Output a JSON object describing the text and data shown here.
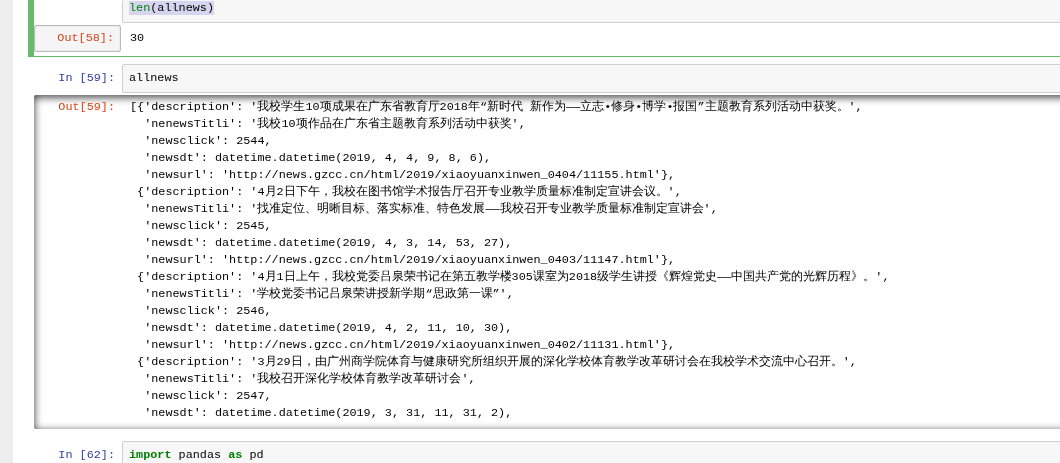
{
  "cells": [
    {
      "selected": true,
      "input": {
        "highlighted": true,
        "code": [
          {
            "text": "len",
            "kind": "builtin"
          },
          {
            "text": "(allnews)",
            "kind": "plain"
          }
        ]
      },
      "output": {
        "prompt": "Out[58]:",
        "hovered": true,
        "scrolled": false,
        "lines": [
          "30"
        ]
      }
    },
    {
      "selected": false,
      "input": {
        "prompt": "In [59]:",
        "highlighted": false,
        "code": [
          {
            "text": "allnews",
            "kind": "plain"
          }
        ]
      },
      "output": {
        "prompt": "Out[59]:",
        "hovered": false,
        "scrolled": true,
        "lines": [
          "[{'description': '我校学生10项成果在广东省教育厅2018年“新时代 新作为——立志•修身•博学•报国”主题教育系列活动中获奖。',",
          "  'nenewsTitli': '我校10项作品在广东省主题教育系列活动中获奖',",
          "  'newsclick': 2544,",
          "  'newsdt': datetime.datetime(2019, 4, 4, 9, 8, 6),",
          "  'newsurl': 'http://news.gzcc.cn/html/2019/xiaoyuanxinwen_0404/11155.html'},",
          " {'description': '4月2日下午，我校在图书馆学术报告厅召开专业教学质量标准制定宣讲会议。',",
          "  'nenewsTitli': '找准定位、明晰目标、落实标准、特色发展——我校召开专业教学质量标准制定宣讲会',",
          "  'newsclick': 2545,",
          "  'newsdt': datetime.datetime(2019, 4, 3, 14, 53, 27),",
          "  'newsurl': 'http://news.gzcc.cn/html/2019/xiaoyuanxinwen_0403/11147.html'},",
          " {'description': '4月1日上午，我校党委吕泉荣书记在第五教学楼305课室为2018级学生讲授《辉煌党史——中国共产党的光辉历程》。',",
          "  'nenewsTitli': '学校党委书记吕泉荣讲授新学期“思政第一课”',",
          "  'newsclick': 2546,",
          "  'newsdt': datetime.datetime(2019, 4, 2, 11, 10, 30),",
          "  'newsurl': 'http://news.gzcc.cn/html/2019/xiaoyuanxinwen_0402/11131.html'},",
          " {'description': '3月29日，由广州商学院体育与健康研究所组织开展的深化学校体育教学改革研讨会在我校学术交流中心召开。',",
          "  'nenewsTitli': '我校召开深化学校体育教学改革研讨会',",
          "  'newsclick': 2547,",
          "  'newsdt': datetime.datetime(2019, 3, 31, 11, 31, 2),"
        ]
      }
    },
    {
      "selected": false,
      "input": {
        "prompt": "In [62]:",
        "highlighted": false,
        "code": [
          {
            "text": "import",
            "kind": "keyword"
          },
          {
            "text": " pandas ",
            "kind": "plain"
          },
          {
            "text": "as",
            "kind": "keyword"
          },
          {
            "text": " pd",
            "kind": "plain"
          }
        ]
      }
    }
  ]
}
